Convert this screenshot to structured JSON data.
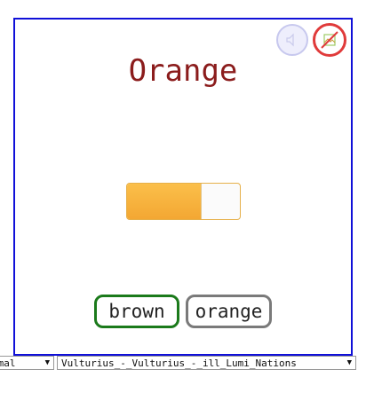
{
  "card": {
    "title": "Orange",
    "title_color": "#8b1c1c",
    "border_color": "#1010d8"
  },
  "controls": {
    "sound_icon": "speaker-icon",
    "no_image_icon": "crossed-image-icon"
  },
  "swatch": {
    "fill_fraction": 0.65,
    "fill_color": "#f7b23f"
  },
  "choices": [
    {
      "label": "brown",
      "border_color": "#1b7a1b"
    },
    {
      "label": "orange",
      "border_color": "#7a7a7a"
    }
  ],
  "bottom_bar": {
    "mode_value": "rmal",
    "voice_value": "Vulturius_-_Vulturius_-_ill_Lumi_Nations"
  }
}
